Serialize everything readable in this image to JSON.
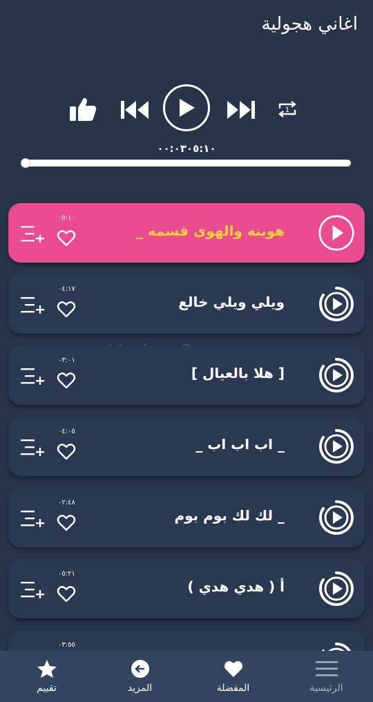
{
  "header": {
    "title": "اغاني هجولية"
  },
  "player": {
    "elapsed": "٠٠:٠٣",
    "total": "٠٥:١٠",
    "progress_fraction": 0.01,
    "repeat_badge": "1"
  },
  "songs": [
    {
      "title": "هويته والهوى قسمه _",
      "duration": "٠٥:١٠",
      "active": true
    },
    {
      "title": "ويلي ويلي  خالع",
      "duration": "٠٤:١٧",
      "active": false
    },
    {
      "title": "[ هلا بالعيال ]",
      "duration": "٠٣:٠١",
      "active": false
    },
    {
      "title": "_ اب اب اب _",
      "duration": "٠٤:٠٥",
      "active": false
    },
    {
      "title": "_ لك لك بوم بوم",
      "duration": "٠٢:٤٨",
      "active": false
    },
    {
      "title": "أ ( هدي هدي )",
      "duration": "٠٥:٢١",
      "active": false
    },
    {
      "title": "",
      "duration": "٠٣:٥٥",
      "active": false
    }
  ],
  "watermark": "UpdateStar.com",
  "nav": {
    "home": "الرئيسية",
    "favorites": "المفضلة",
    "more": "المزيد",
    "rate": "تقييم"
  },
  "colors": {
    "background": "#27344a",
    "active_row": "#ea4c8f",
    "active_title": "#ffd23c",
    "nav_bar": "#33445e"
  }
}
